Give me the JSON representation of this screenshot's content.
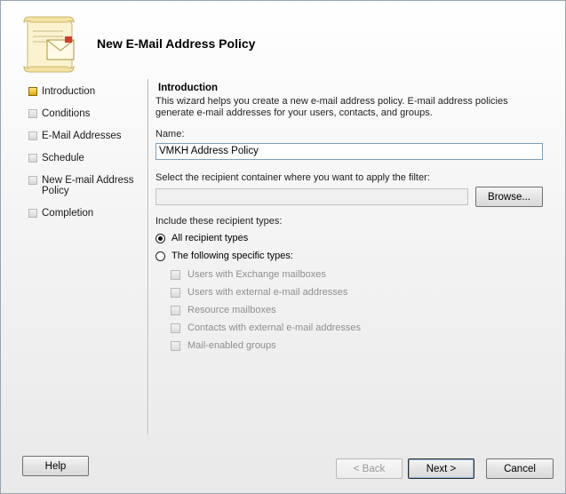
{
  "wizard": {
    "title": "New E-Mail Address Policy"
  },
  "nav": {
    "items": [
      {
        "label": "Introduction",
        "active": true
      },
      {
        "label": "Conditions",
        "active": false
      },
      {
        "label": "E-Mail Addresses",
        "active": false
      },
      {
        "label": "Schedule",
        "active": false
      },
      {
        "label": "New E-mail Address Policy",
        "active": false
      },
      {
        "label": "Completion",
        "active": false
      }
    ]
  },
  "main": {
    "section_title": "Introduction",
    "description": "This wizard helps you create a new e-mail address policy. E-mail address policies generate e-mail addresses for your users, contacts, and groups.",
    "name_label": "Name:",
    "name_value": "VMKH Address Policy",
    "container_label": "Select the recipient container where you want to apply the filter:",
    "container_value": "",
    "browse_label": "Browse...",
    "types_label": "Include these recipient types:",
    "radio_all": "All recipient types",
    "radio_specific": "The following specific types:",
    "specific_types": [
      "Users with Exchange mailboxes",
      "Users with external e-mail addresses",
      "Resource mailboxes",
      "Contacts with external e-mail addresses",
      "Mail-enabled groups"
    ]
  },
  "buttons": {
    "help": "Help",
    "back": "< Back",
    "next": "Next >",
    "cancel": "Cancel"
  },
  "icons": {
    "header": "scroll-envelope-icon"
  },
  "colors": {
    "active_step": "#e0a800",
    "textbox_border": "#7f9db9"
  }
}
